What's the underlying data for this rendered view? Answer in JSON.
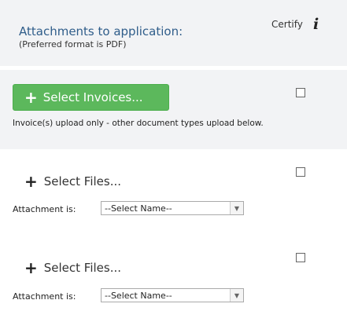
{
  "header": {
    "title": "Attachments to application:",
    "subtitle": "(Preferred format is PDF)",
    "certify_label": "Certify",
    "info_icon": "i"
  },
  "invoice_section": {
    "button_label": "Select Invoices...",
    "note": "Invoice(s) upload only - other document types upload below."
  },
  "file_sections": [
    {
      "button_label": "Select Files...",
      "attachment_label": "Attachment is:",
      "select_value": "--Select Name--"
    },
    {
      "button_label": "Select Files...",
      "attachment_label": "Attachment is:",
      "select_value": "--Select Name--"
    }
  ],
  "colors": {
    "title_blue": "#2f5d8a",
    "button_green": "#5cb85c",
    "band_gray": "#f2f3f5"
  }
}
